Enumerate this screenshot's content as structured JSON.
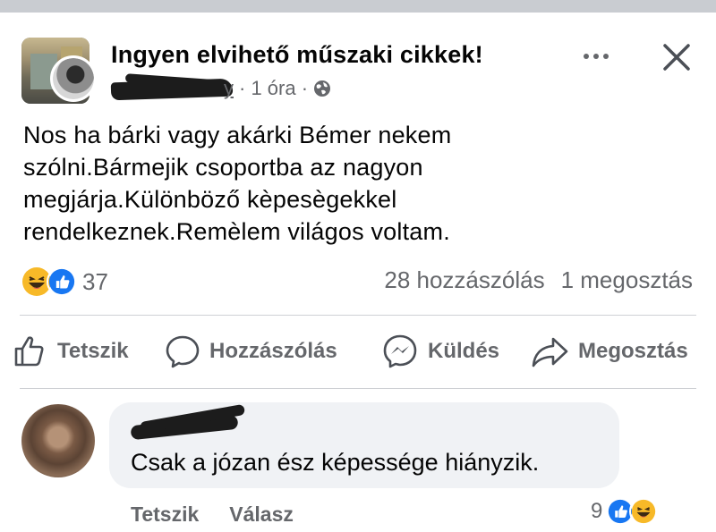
{
  "post": {
    "group_name": "Ingyen elvihető műszaki cikkek!",
    "author_partial": "y",
    "time": "· 1 óra ·",
    "text_lines": [
      "Nos ha bárki vagy akárki Bémer nekem",
      "szólni.Bármejik csoportba az nagyon",
      "megjárja.Különböző kèpesègekkel",
      "rendelkeznek.Remèlem világos voltam."
    ],
    "reaction_count": "37",
    "comments_count": "28 hozzászólás",
    "shares_count": "1 megosztás"
  },
  "actions": {
    "like": "Tetszik",
    "comment": "Hozzászólás",
    "send": "Küldés",
    "share": "Megosztás"
  },
  "comment": {
    "text": "Csak a józan ész képessége hiányzik.",
    "like_label": "Tetszik",
    "reply_label": "Válasz",
    "reaction_count": "9"
  },
  "icons": {
    "like": "like-reaction-icon",
    "haha": "haha-reaction-icon",
    "globe": "globe-icon",
    "more": "more-options-icon",
    "close": "close-icon"
  },
  "colors": {
    "brand_blue": "#1877f2",
    "secondary_text": "#65676b",
    "haha_yellow": "#f7b928",
    "bubble_bg": "#f0f2f5"
  }
}
